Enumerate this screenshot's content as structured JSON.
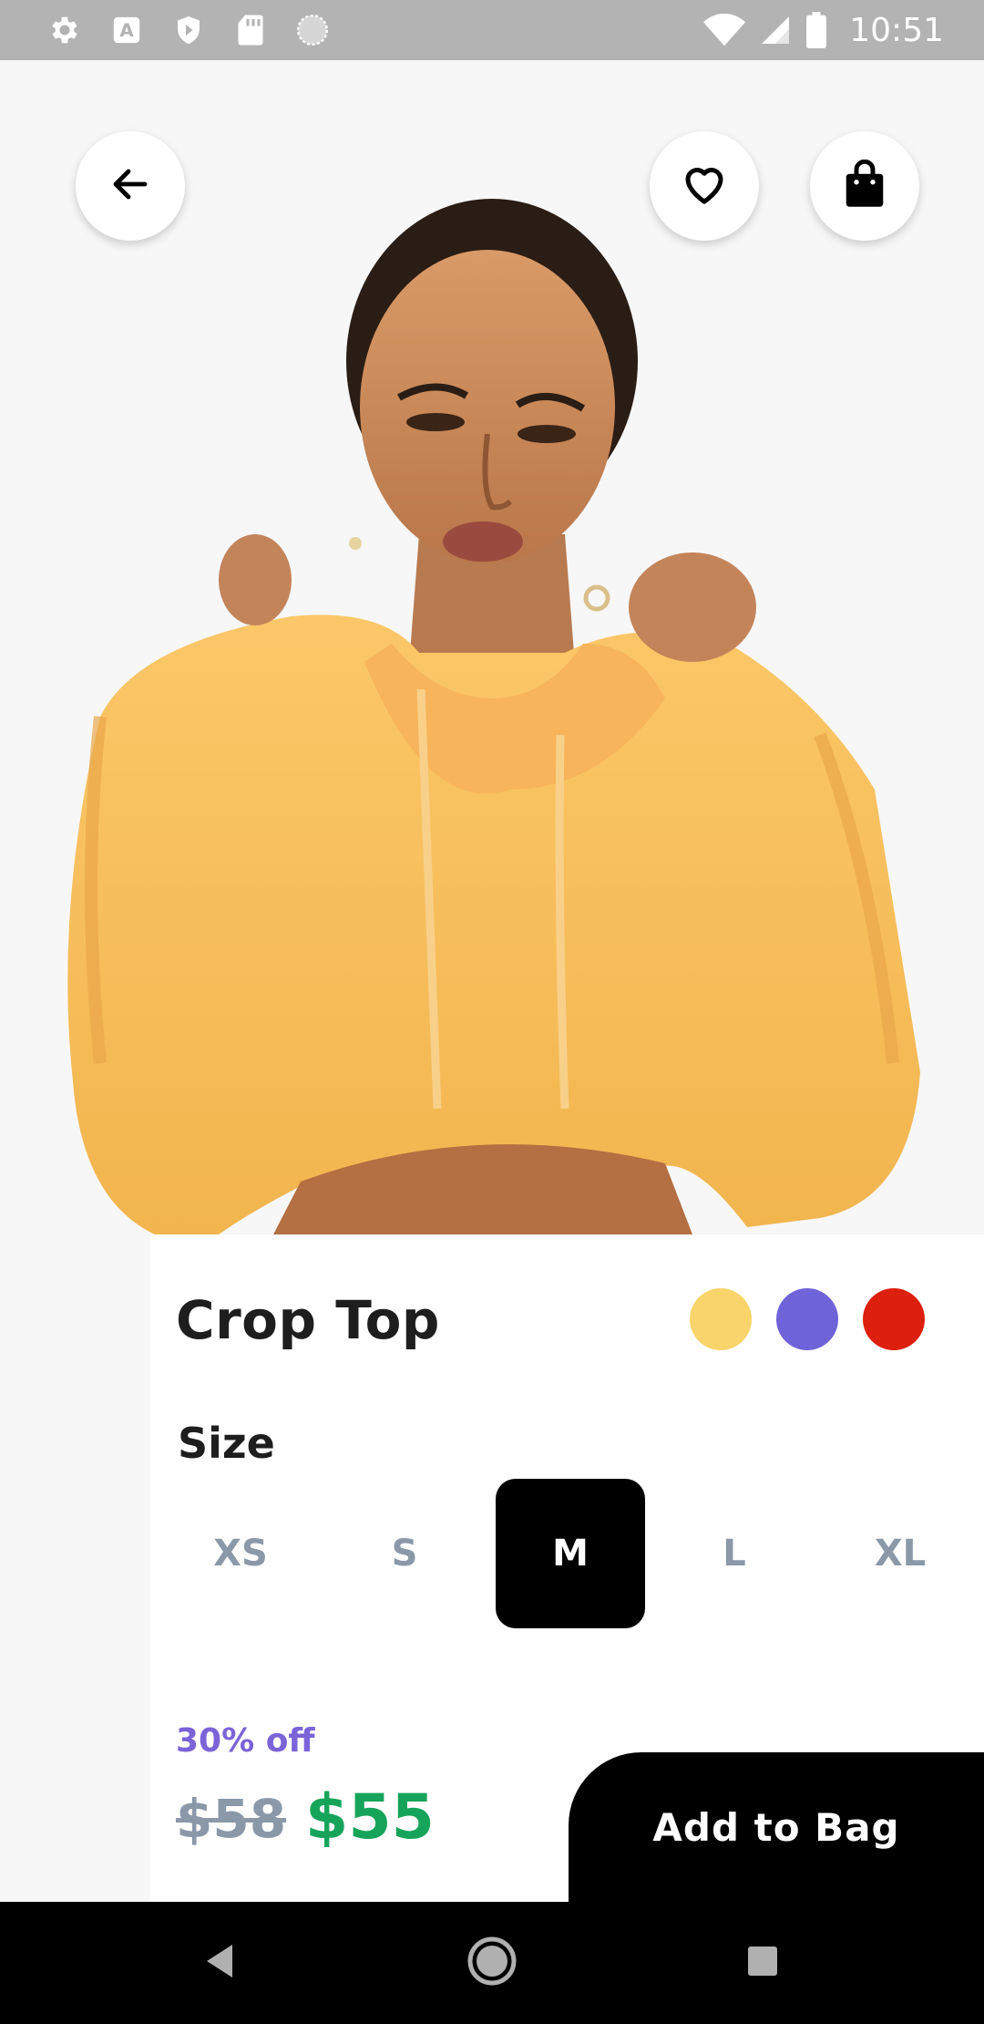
{
  "status_bar": {
    "time": "10:51",
    "left_icons": [
      "settings-icon",
      "keyboard-a-icon",
      "shield-icon",
      "sd-card-icon",
      "circle-icon"
    ],
    "right_icons": [
      "wifi-icon",
      "cell-signal-icon",
      "battery-icon"
    ]
  },
  "header": {
    "back_icon": "arrow-left-icon",
    "favorite_icon": "heart-icon",
    "bag_icon": "shopping-bag-icon"
  },
  "product": {
    "title": "Crop Top",
    "colors": [
      {
        "name": "yellow",
        "hex": "#f9d46b"
      },
      {
        "name": "purple",
        "hex": "#6e63d8"
      },
      {
        "name": "red",
        "hex": "#dd1f0e"
      }
    ],
    "size_heading": "Size",
    "sizes": [
      "XS",
      "S",
      "M",
      "L",
      "XL"
    ],
    "selected_size": "M",
    "discount": "30% off",
    "old_price": "$58",
    "price": "$55"
  },
  "actions": {
    "add_to_bag": "Add to Bag"
  },
  "nav_bar": {
    "items": [
      "back-triangle-icon",
      "home-circle-icon",
      "recents-square-icon"
    ]
  },
  "colors": {
    "accent_purple": "#7b63d8",
    "price_green": "#16a45a",
    "muted": "#8a98a8"
  }
}
